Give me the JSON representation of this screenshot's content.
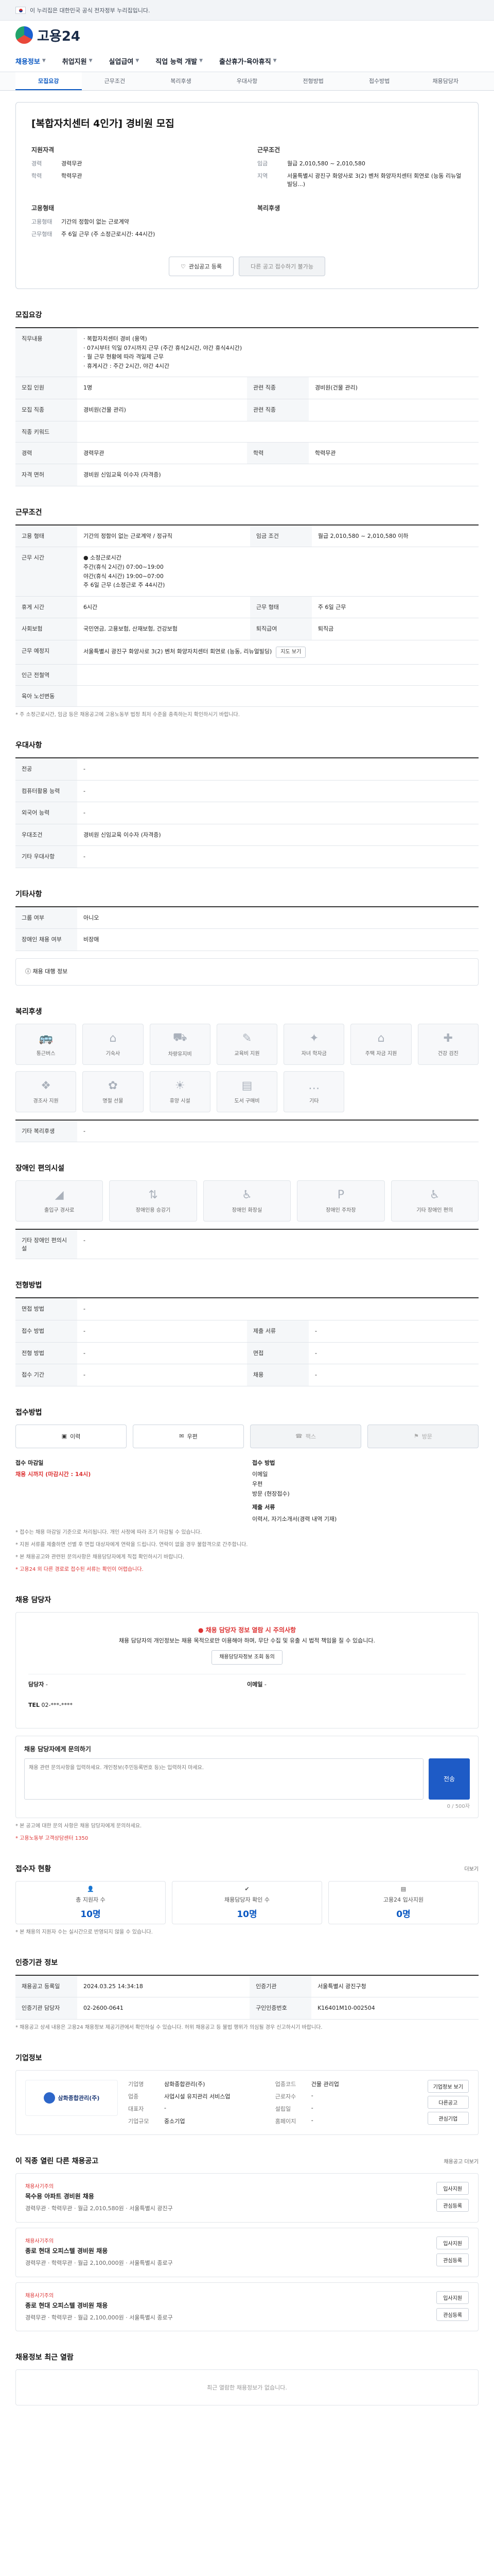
{
  "gov_bar": {
    "text": "이 누리집은 대한민국 공식 전자정부 누리집입니다.",
    "toggle": ""
  },
  "header": {
    "logo_text": "고용24",
    "gnb": [
      {
        "label": "채용정보",
        "active": true
      },
      {
        "label": "취업지원",
        "active": false
      },
      {
        "label": "실업급여",
        "active": false
      },
      {
        "label": "직업 능력 개발",
        "active": false
      },
      {
        "label": "출산휴가·육아휴직",
        "active": false
      }
    ]
  },
  "tabs": [
    "모집요강",
    "근무조건",
    "복리후생",
    "우대사항",
    "전형방법",
    "접수방법",
    "채용담당자"
  ],
  "summary": {
    "company": "",
    "title": "[복합자치센터 4인가] 경비원 모집",
    "blocks": [
      {
        "heading": "지원자격",
        "rows": [
          {
            "k": "경력",
            "v": "경력무관"
          },
          {
            "k": "학력",
            "v": "학력무관"
          }
        ]
      },
      {
        "heading": "근무조건",
        "rows": [
          {
            "k": "임금",
            "v": "월급 2,010,580 ~ 2,010,580"
          },
          {
            "k": "지역",
            "v": "서울특별시 광진구 화양사로 3(2) 벤처 화양자치센터 회연로 (능동 리뉴얼빌딩...)"
          }
        ]
      },
      {
        "heading": "고용형태",
        "rows": [
          {
            "k": "고용형태",
            "v": "기간의 정함이 없는 근로계약"
          },
          {
            "k": "근무형태",
            "v": "주 6일 근무 (주 소정근로시간: 44시간)"
          }
        ]
      },
      {
        "heading": "복리후생",
        "rows": []
      }
    ],
    "btn_interest": "관심공고 등록",
    "btn_share": "다른 공고 접수하기 불가능"
  },
  "recruit": {
    "title": "모집요강",
    "job_desc_label": "직무내용",
    "job_desc": "· 복합자치센터 경비 (용역)\n· 07시부터 익일 07시까지 근무 (주간 휴식2시간, 야간 휴식4시간)\n· 월 근무 현황에 따라 격일제 근무\n· 휴게시간 : 주간 2시간, 야간 4시간",
    "rows": [
      {
        "k": "모집 인원",
        "v": "1명",
        "k2": "관련 직종",
        "v2": "경비원(건물 관리)"
      },
      {
        "k": "모집 직종",
        "v": "경비원(건물 관리)",
        "k2": "관련 직종",
        "v2": ""
      },
      {
        "k": "직종 키워드",
        "v": "",
        "k2": "",
        "v2": ""
      },
      {
        "k": "경력",
        "v": "경력무관",
        "k2": "학력",
        "v2": "학력무관"
      },
      {
        "k": "자격 면허",
        "v": "경비원 신임교육 이수자 (자격증)",
        "k2": "",
        "v2": ""
      }
    ]
  },
  "conditions": {
    "title": "근무조건",
    "rows": [
      {
        "k": "고용 형태",
        "v": "기간의 정함이 없는 근로계약 / 정규직",
        "k2": "임금 조건",
        "v2": "월급 2,010,580 ~ 2,010,580 이하"
      },
      {
        "k": "근무 시간",
        "v": "● 소정근로시간 \n주간(휴식 2시간) 07:00~19:00\n야간(휴식 4시간) 19:00~07:00 \n 주 6일 근무 (소정근로 주 44시간)",
        "k2": "",
        "v2": ""
      },
      {
        "k": "휴게 시간",
        "v": "6시간",
        "k2": "근무 형태",
        "v2": "주 6일 근무"
      },
      {
        "k": "사회보험",
        "v": "국민연금, 고용보험, 산재보험, 건강보험",
        "k2": "퇴직급여",
        "v2": "퇴직금"
      },
      {
        "k": "근무 예정지",
        "v": "서울특별시 광진구 화양사로 3(2) 벤처 화양자치센터 회연로 (능동, 리뉴얼빌딩)",
        "k2": "",
        "v2": ""
      },
      {
        "k": "인근 전철역",
        "v": "",
        "k2": "",
        "v2": ""
      },
      {
        "k": "육아 노선변동",
        "v": "",
        "k2": "",
        "v2": ""
      }
    ],
    "map_btn": "지도 보기",
    "notice": "* 주 소정근로시간, 임금 등은 채용공고에 고용노동부 법정 최저 수준을 충족하는지 확인하시기 바랍니다."
  },
  "prefer": {
    "title": "우대사항",
    "rows": [
      {
        "k": "전공",
        "v": "-"
      },
      {
        "k": "컴퓨터활용 능력",
        "v": "-"
      },
      {
        "k": "외국어 능력",
        "v": "-"
      },
      {
        "k": "우대조건",
        "v": "경비원 신임교육 이수자 (자격증)"
      },
      {
        "k": "기타 우대사항",
        "v": "-"
      }
    ]
  },
  "etc": {
    "title": "기타사항",
    "rows": [
      {
        "k": "그룹 여부",
        "v": "아니오"
      },
      {
        "k": "장애인 채용 여부",
        "v": "비장애"
      }
    ],
    "notice_btn": "채용 대행 정보"
  },
  "welfare": {
    "title": "복리후생",
    "items": [
      "통근버스",
      "기숙사",
      "차량유지비",
      "교육비 지원",
      "자녀 학자금",
      "주택 자금 지원",
      "건강 검진",
      "경조사 지원",
      "명절 선물",
      "휴양 시설",
      "도서 구매비",
      "기타"
    ],
    "etc_label": "기타 복리후생",
    "etc_value": "-"
  },
  "disabled": {
    "title": "장애인 편의시설",
    "items": [
      "출입구 경사로",
      "장애인용 승강기",
      "장애인 화장실",
      "장애인 주차장",
      "기타 장애인 편의"
    ],
    "etc_label": "기타 장애인 편의시설",
    "etc_value": "-"
  },
  "screening": {
    "title": "전형방법",
    "rows": [
      {
        "k": "면접 방법",
        "v": "-",
        "k2": "",
        "v2": ""
      },
      {
        "k": "접수 방법",
        "v": "-",
        "k2": "제출 서류",
        "v2": "-"
      },
      {
        "k": "전형 방법",
        "v": "-",
        "k2": "면접",
        "v2": "-"
      },
      {
        "k": "접수 기간",
        "v": "-",
        "k2": "채용",
        "v2": "-"
      }
    ]
  },
  "apply": {
    "title": "접수방법",
    "methods": [
      {
        "label": "이력",
        "active": true
      },
      {
        "label": "우편",
        "active": true
      },
      {
        "label": "팩스",
        "active": false
      },
      {
        "label": "방문",
        "active": false
      }
    ],
    "left_label": "접수 마감일",
    "left_value": "채용 시까지 (마감시간 : 14시)",
    "right_label": "접수 방법",
    "right_lines": [
      "이메일",
      "우편",
      "방문 (현장접수)"
    ],
    "doc_label": "제출 서류",
    "doc_value": "이력서, 자기소개서(경력 내역 기재)",
    "notes": [
      "* 접수는 채용 마감일 기준으로 처리됩니다. 개인 사정에 따라 조기 마감될 수 있습니다.",
      "* 지원 서류를 제출하면 선별 후 면접 대상자에게 연락을 드립니다. 연락이 없을 경우 불합격으로 간주합니다.",
      "* 본 채용공고와 관련된 문의사항은 채용담당자에게 직접 확인하시기 바랍니다.",
      "* 고용24 외 다른 경로로 접수된 서류는 확인이 어렵습니다."
    ]
  },
  "manager": {
    "title": "채용 담당자",
    "warn": "채용 담당자 정보 열람 시 주의사항",
    "desc": "채용 담당자의 개인정보는 채용 목적으로만 이용해야 하며, 무단 수집 및 유출 시 법적 책임을 질 수 있습니다.",
    "btn": "채용담당자정보 조회 동의",
    "name_label": "담당자",
    "name_value": "-",
    "tel_label": "TEL",
    "tel_value": "02-***-****",
    "email_label": "이메일",
    "email_value": "-",
    "inquiry_title": "채용 담당자에게 문의하기",
    "inquiry_placeholder": "채용 관련 문의사항을 입력하세요. 개인정보(주민등록번호 등)는 입력하지 마세요.",
    "inquiry_count": "0 / 500자",
    "send": "전송",
    "notice1": "* 본 공고에 대한 문의 사항은 채용 담당자에게 문의하세요.",
    "notice2": "* 고용노동부 고객상담센터 1350"
  },
  "stats": {
    "title": "접수자 현황",
    "more": "더보기",
    "items": [
      {
        "label": "총 지원자 수",
        "value": "10명"
      },
      {
        "label": "채용담당자 확인 수",
        "value": "10명"
      },
      {
        "label": "고용24 입사지원",
        "value": "0명"
      }
    ],
    "note": "* 본 채용의 지원자 수는 실시간으로 반영되지 않을 수 있습니다."
  },
  "approval": {
    "title": "인증기관 정보",
    "rows": [
      {
        "k": "채용공고 등록일",
        "v": "2024.03.25 14:34:18",
        "k2": "인증기관",
        "v2": "서울특별시 광진구청"
      },
      {
        "k": "인증기관 담당자",
        "v": "02-2600-0641",
        "k2": "구인인증번호",
        "v2": "K16401M10-002504"
      }
    ],
    "note": "* 채용공고 상세 내용은 고용24 채용정보 제공기관에서 확인하실 수 있습니다. 허위 채용공고 등 불법 행위가 의심될 경우 신고하시기 바랍니다."
  },
  "company": {
    "title": "기업정보",
    "logo": "삼화종합관리(주)",
    "rows": [
      {
        "k": "기업명",
        "v": "삼화종합관리(주)",
        "k2": "업종코드",
        "v2": "건물 관리업"
      },
      {
        "k": "업종",
        "v": "사업시설 유지관리 서비스업",
        "k2": "근로자수",
        "v2": "-"
      },
      {
        "k": "대표자",
        "v": "-",
        "k2": "설립일",
        "v2": "-"
      },
      {
        "k": "기업규모",
        "v": "중소기업",
        "k2": "홈페이지",
        "v2": "-"
      }
    ],
    "btn1": "기업정보 보기",
    "btn2": "다른공고",
    "btn3": "관심기업"
  },
  "related": {
    "title": "이 직종 열린 다른 채용공고",
    "more": "채용공고 더보기",
    "jobs": [
      {
        "co": "채용사기주의",
        "title": "목수용 아파트 경비원 채용",
        "meta": "경력무관 · 학력무관 · 월급 2,010,580원 · 서울특별시 광진구"
      },
      {
        "co": "채용사기주의",
        "title": "종로 현대 오피스텔 경비원 채용",
        "meta": "경력무관 · 학력무관 · 월급 2,100,000원 · 서울특별시 종로구"
      },
      {
        "co": "채용사기주의",
        "title": "종로 현대 오피스텔 경비원 채용",
        "meta": "경력무관 · 학력무관 · 월급 2,100,000원 · 서울특별시 종로구"
      }
    ],
    "btn_apply": "입사지원",
    "btn_scrap": "관심등록"
  },
  "recent": {
    "title": "채용정보 최근 열람",
    "empty": "최근 열람한 채용정보가 없습니다."
  }
}
